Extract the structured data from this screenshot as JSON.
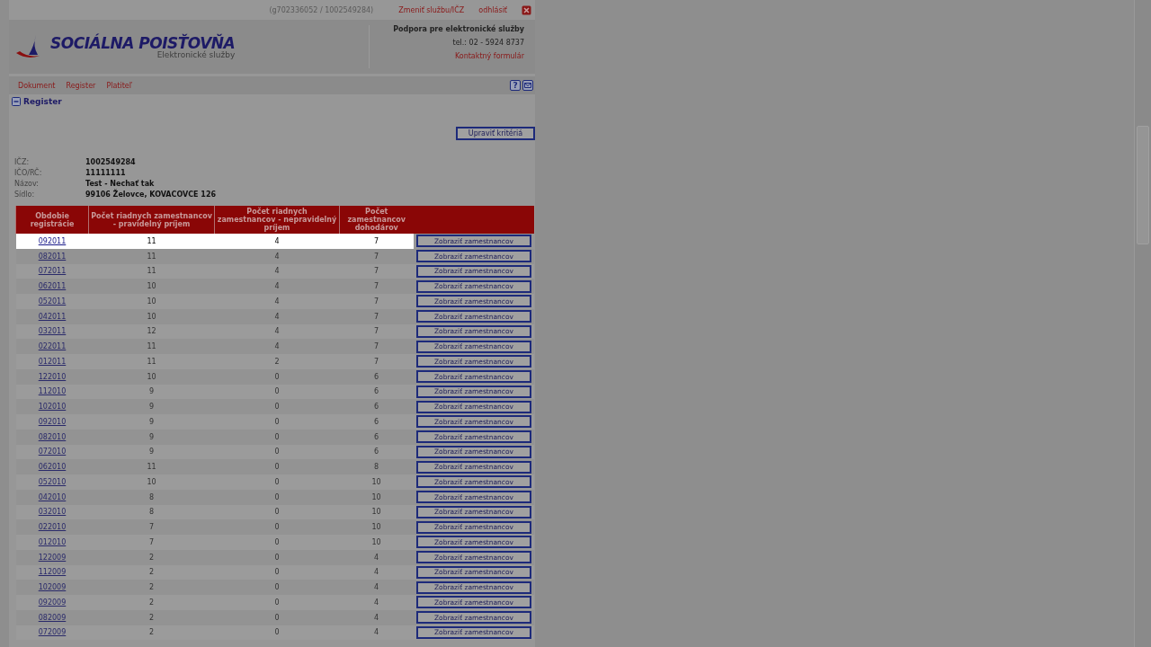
{
  "top_bar": {
    "account": "(g702336052 / 1002549284)",
    "links": [
      "Zmeniť službu/IČZ",
      "odhlásiť"
    ]
  },
  "header": {
    "logo_title": "SOCIÁLNA POISŤOVŇA",
    "logo_subtitle": "Elektronické služby",
    "support_title": "Podpora pre elektronické služby",
    "phone": "tel.: 02 - 5924 8737",
    "contact_link": "Kontaktný formulár"
  },
  "nav": {
    "items": [
      "Dokument",
      "Register",
      "Platiteľ"
    ],
    "help": "?"
  },
  "section": {
    "title": "Register",
    "expanded": true
  },
  "edit_button": "Upraviť kritériá",
  "info": [
    {
      "label": "IČZ:",
      "value": "1002549284"
    },
    {
      "label": "IČO/RČ:",
      "value": "11111111"
    },
    {
      "label": "Názov:",
      "value": "Test - Nechať tak"
    },
    {
      "label": "Sídlo:",
      "value": "99106 Želovce, KOVACOVCE 126"
    }
  ],
  "table": {
    "columns": [
      "Obdobie registrácie",
      "Počet riadnych zamestnancov - pravidelný príjem",
      "Počet riadnych zamestnancov - nepravidelný príjem",
      "Počet zamestnancov dohodárov"
    ],
    "rows": [
      {
        "period": "092011",
        "regular": "11",
        "irregular": "4",
        "agreement": "7",
        "button": "Zobraziť zamestnancov",
        "selected": true
      },
      {
        "period": "082011",
        "regular": "11",
        "irregular": "4",
        "agreement": "7",
        "button": "Zobraziť zamestnancov",
        "selected": false
      },
      {
        "period": "072011",
        "regular": "11",
        "irregular": "4",
        "agreement": "7",
        "button": "Zobraziť zamestnancov",
        "selected": false
      },
      {
        "period": "062011",
        "regular": "10",
        "irregular": "4",
        "agreement": "7",
        "button": "Zobraziť zamestnancov",
        "selected": false
      },
      {
        "period": "052011",
        "regular": "10",
        "irregular": "4",
        "agreement": "7",
        "button": "Zobraziť zamestnancov",
        "selected": false
      },
      {
        "period": "042011",
        "regular": "10",
        "irregular": "4",
        "agreement": "7",
        "button": "Zobraziť zamestnancov",
        "selected": false
      },
      {
        "period": "032011",
        "regular": "12",
        "irregular": "4",
        "agreement": "7",
        "button": "Zobraziť zamestnancov",
        "selected": false
      },
      {
        "period": "022011",
        "regular": "11",
        "irregular": "4",
        "agreement": "7",
        "button": "Zobraziť zamestnancov",
        "selected": false
      },
      {
        "period": "012011",
        "regular": "11",
        "irregular": "2",
        "agreement": "7",
        "button": "Zobraziť zamestnancov",
        "selected": false
      },
      {
        "period": "122010",
        "regular": "10",
        "irregular": "0",
        "agreement": "6",
        "button": "Zobraziť zamestnancov",
        "selected": false
      },
      {
        "period": "112010",
        "regular": "9",
        "irregular": "0",
        "agreement": "6",
        "button": "Zobraziť zamestnancov",
        "selected": false
      },
      {
        "period": "102010",
        "regular": "9",
        "irregular": "0",
        "agreement": "6",
        "button": "Zobraziť zamestnancov",
        "selected": false
      },
      {
        "period": "092010",
        "regular": "9",
        "irregular": "0",
        "agreement": "6",
        "button": "Zobraziť zamestnancov",
        "selected": false
      },
      {
        "period": "082010",
        "regular": "9",
        "irregular": "0",
        "agreement": "6",
        "button": "Zobraziť zamestnancov",
        "selected": false
      },
      {
        "period": "072010",
        "regular": "9",
        "irregular": "0",
        "agreement": "6",
        "button": "Zobraziť zamestnancov",
        "selected": false
      },
      {
        "period": "062010",
        "regular": "11",
        "irregular": "0",
        "agreement": "8",
        "button": "Zobraziť zamestnancov",
        "selected": false
      },
      {
        "period": "052010",
        "regular": "10",
        "irregular": "0",
        "agreement": "10",
        "button": "Zobraziť zamestnancov",
        "selected": false
      },
      {
        "period": "042010",
        "regular": "8",
        "irregular": "0",
        "agreement": "10",
        "button": "Zobraziť zamestnancov",
        "selected": false
      },
      {
        "period": "032010",
        "regular": "8",
        "irregular": "0",
        "agreement": "10",
        "button": "Zobraziť zamestnancov",
        "selected": false
      },
      {
        "period": "022010",
        "regular": "7",
        "irregular": "0",
        "agreement": "10",
        "button": "Zobraziť zamestnancov",
        "selected": false
      },
      {
        "period": "012010",
        "regular": "7",
        "irregular": "0",
        "agreement": "10",
        "button": "Zobraziť zamestnancov",
        "selected": false
      },
      {
        "period": "122009",
        "regular": "2",
        "irregular": "0",
        "agreement": "4",
        "button": "Zobraziť zamestnancov",
        "selected": false
      },
      {
        "period": "112009",
        "regular": "2",
        "irregular": "0",
        "agreement": "4",
        "button": "Zobraziť zamestnancov",
        "selected": false
      },
      {
        "period": "102009",
        "regular": "2",
        "irregular": "0",
        "agreement": "4",
        "button": "Zobraziť zamestnancov",
        "selected": false
      },
      {
        "period": "092009",
        "regular": "2",
        "irregular": "0",
        "agreement": "4",
        "button": "Zobraziť zamestnancov",
        "selected": false
      },
      {
        "period": "082009",
        "regular": "2",
        "irregular": "0",
        "agreement": "4",
        "button": "Zobraziť zamestnancov",
        "selected": false
      },
      {
        "period": "072009",
        "regular": "2",
        "irregular": "0",
        "agreement": "4",
        "button": "Zobraziť zamestnancov",
        "selected": false
      }
    ]
  }
}
